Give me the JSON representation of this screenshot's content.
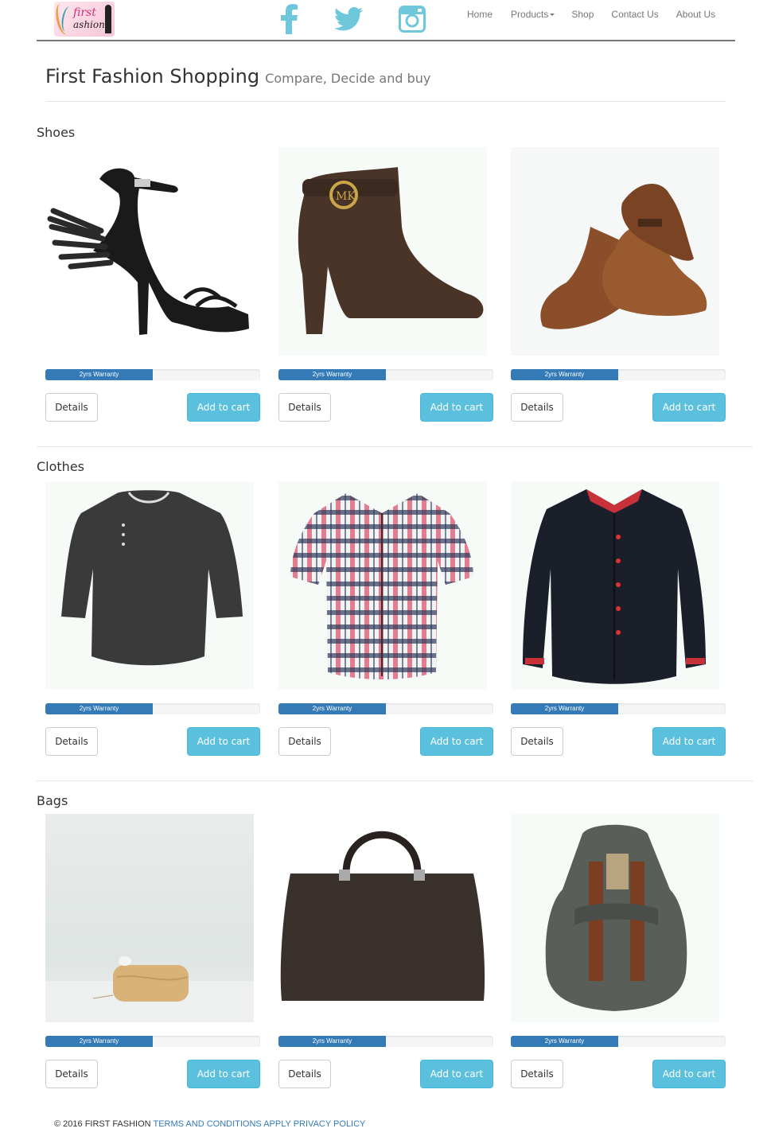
{
  "brand": {
    "logo_line1": "first",
    "logo_line2": "ashion"
  },
  "nav": {
    "home": "Home",
    "products": "Products",
    "shop": "Shop",
    "contact": "Contact Us",
    "about": "About Us"
  },
  "colors": {
    "social": "#6fc7dc",
    "primary": "#337ab7",
    "info": "#5bc0de"
  },
  "header": {
    "title": "First Fashion Shopping",
    "subtitle": "Compare, Decide and buy"
  },
  "sections": [
    {
      "title": "Shoes",
      "products": [
        {
          "image": "black strappy winged heel sandal",
          "warranty": "2yrs Warranty",
          "warranty_progress": 0.5,
          "details": "Details",
          "cart": "Add to cart"
        },
        {
          "image": "brown ankle boot with MK logo",
          "warranty": "2yrs Warranty",
          "warranty_progress": 0.5,
          "details": "Details",
          "cart": "Add to cart"
        },
        {
          "image": "brown leather monk strap shoes",
          "warranty": "2yrs Warranty",
          "warranty_progress": 0.5,
          "details": "Details",
          "cart": "Add to cart"
        }
      ]
    },
    {
      "title": "Clothes",
      "products": [
        {
          "image": "dark grey henley t-shirt",
          "warranty": "2yrs Warranty",
          "warranty_progress": 0.5,
          "details": "Details",
          "cart": "Add to cart"
        },
        {
          "image": "pink and navy plaid shirt",
          "warranty": "2yrs Warranty",
          "warranty_progress": 0.5,
          "details": "Details",
          "cart": "Add to cart"
        },
        {
          "image": "black shirt with red buttons",
          "warranty": "2yrs Warranty",
          "warranty_progress": 0.5,
          "details": "Details",
          "cart": "Add to cart"
        }
      ]
    },
    {
      "title": "Bags",
      "products": [
        {
          "image": "wooden clutch bag",
          "warranty": "2yrs Warranty",
          "warranty_progress": 0.5,
          "details": "Details",
          "cart": "Add to cart"
        },
        {
          "image": "dark brown leather handbag",
          "warranty": "2yrs Warranty",
          "warranty_progress": 0.5,
          "details": "Details",
          "cart": "Add to cart"
        },
        {
          "image": "grey canvas backpack",
          "warranty": "2yrs Warranty",
          "warranty_progress": 0.5,
          "details": "Details",
          "cart": "Add to cart"
        }
      ]
    }
  ],
  "footer": {
    "copyright": "© 2016 FIRST FASHION",
    "terms": "TERMS AND CONDITIONS APPLY",
    "privacy": "PRIVACY POLICY"
  }
}
